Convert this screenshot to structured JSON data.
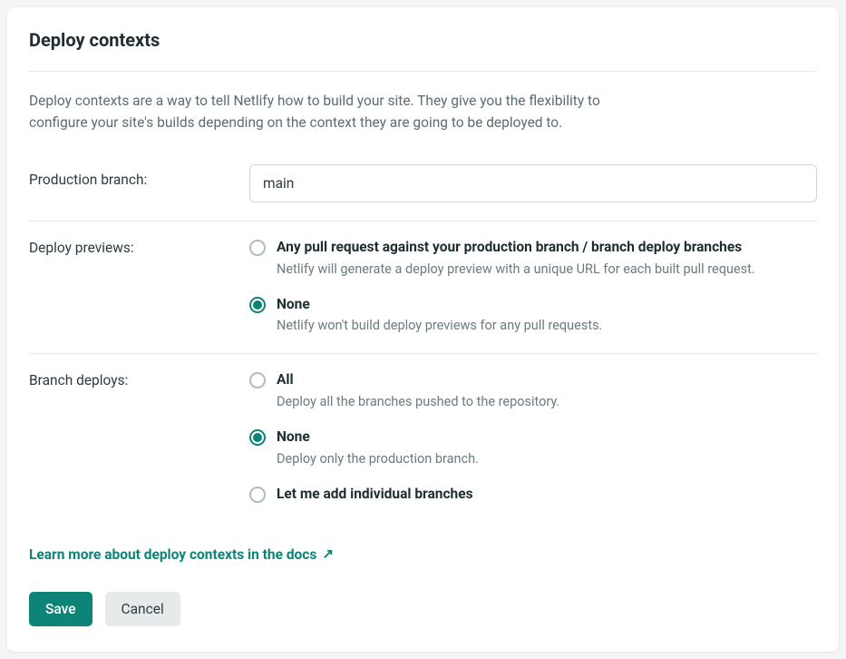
{
  "header": {
    "title": "Deploy contexts"
  },
  "description": "Deploy contexts are a way to tell Netlify how to build your site. They give you the flexibility to configure your site's builds depending on the context they are going to be deployed to.",
  "fields": {
    "production_branch": {
      "label": "Production branch:",
      "value": "main"
    },
    "deploy_previews": {
      "label": "Deploy previews:",
      "options": [
        {
          "title": "Any pull request against your production branch / branch deploy branches",
          "description": "Netlify will generate a deploy preview with a unique URL for each built pull request.",
          "selected": false
        },
        {
          "title": "None",
          "description": "Netlify won't build deploy previews for any pull requests.",
          "selected": true
        }
      ]
    },
    "branch_deploys": {
      "label": "Branch deploys:",
      "options": [
        {
          "title": "All",
          "description": "Deploy all the branches pushed to the repository.",
          "selected": false
        },
        {
          "title": "None",
          "description": "Deploy only the production branch.",
          "selected": true
        },
        {
          "title": "Let me add individual branches",
          "description": "",
          "selected": false
        }
      ]
    }
  },
  "learn_more": {
    "label": "Learn more about deploy contexts in the docs"
  },
  "buttons": {
    "save": "Save",
    "cancel": "Cancel"
  }
}
